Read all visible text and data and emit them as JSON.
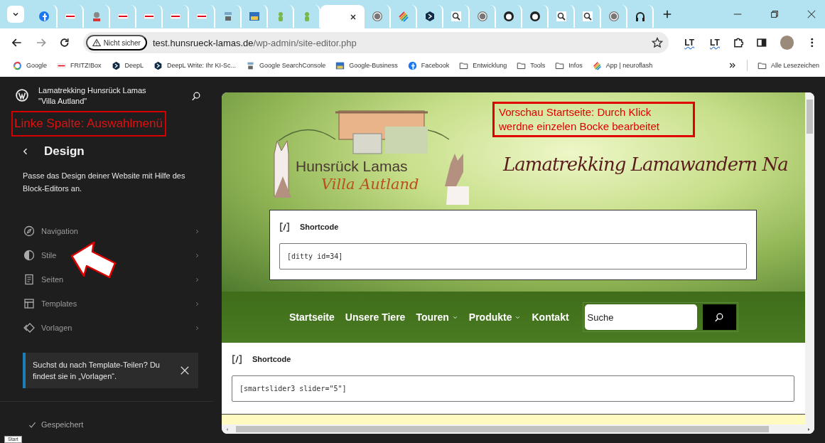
{
  "browser": {
    "tabs": [
      {
        "kind": "round",
        "selected": false
      },
      {
        "kind": "flag",
        "selected": false
      },
      {
        "kind": "person",
        "selected": false
      },
      {
        "kind": "flag",
        "selected": false
      },
      {
        "kind": "flag",
        "selected": false
      },
      {
        "kind": "flag",
        "selected": false
      },
      {
        "kind": "flag",
        "selected": false
      },
      {
        "kind": "server",
        "selected": false
      },
      {
        "kind": "grid",
        "selected": false
      },
      {
        "kind": "figure",
        "selected": false
      },
      {
        "kind": "figure",
        "selected": false
      },
      {
        "kind": "blank",
        "selected": true
      },
      {
        "kind": "wp",
        "selected": false
      },
      {
        "kind": "stripes",
        "selected": false
      },
      {
        "kind": "hex",
        "selected": false
      },
      {
        "kind": "magnifier",
        "selected": false
      },
      {
        "kind": "wp",
        "selected": false
      },
      {
        "kind": "github",
        "selected": false
      },
      {
        "kind": "github",
        "selected": false
      },
      {
        "kind": "magnifier",
        "selected": false
      },
      {
        "kind": "magnifier",
        "selected": false
      },
      {
        "kind": "wp",
        "selected": false
      },
      {
        "kind": "headphones",
        "selected": false
      }
    ],
    "address": {
      "security": "Nicht sicher",
      "host": "test.hunsrueck-lamas.de",
      "path": "/wp-admin/site-editor.php"
    },
    "extensions": [
      {
        "label": "LT"
      },
      {
        "label": "LT"
      }
    ],
    "bookmarks": [
      {
        "label": "Google",
        "kind": "gring"
      },
      {
        "label": "FRITZ!Box",
        "kind": "flag"
      },
      {
        "label": "DeepL",
        "kind": "hex"
      },
      {
        "label": "DeepL Write: Ihr KI-Sc...",
        "kind": "hex"
      },
      {
        "label": "Google SearchConsole",
        "kind": "server"
      },
      {
        "label": "Google-Business",
        "kind": "grid"
      },
      {
        "label": "Facebook",
        "kind": "round"
      },
      {
        "label": "Entwicklung",
        "kind": "folder"
      },
      {
        "label": "Tools",
        "kind": "folder"
      },
      {
        "label": "Infos",
        "kind": "folder"
      },
      {
        "label": "App | neuroflash",
        "kind": "stripes"
      }
    ],
    "all_bookmarks": "Alle Lesezeichen"
  },
  "sidebar": {
    "site_title": "Lamatrekking Hunsrück Lamas \"Villa Autland\"",
    "annotation": "Linke Spalte: Auswahlmenü",
    "heading": "Design",
    "description": "Passe das Design deiner Website mit Hilfe des Block-Editors an.",
    "items": [
      {
        "label": "Navigation",
        "kind": "navigation"
      },
      {
        "label": "Stile",
        "kind": "styles"
      },
      {
        "label": "Seiten",
        "kind": "pages"
      },
      {
        "label": "Templates",
        "kind": "templates"
      },
      {
        "label": "Vorlagen",
        "kind": "patterns"
      }
    ],
    "notice": "Suchst du nach Template-Teilen? Du findest sie in „Vorlagen“.",
    "save_status": "Gespeichert"
  },
  "preview": {
    "logo_title": "Hunsrück Lamas",
    "logo_subtitle": "Villa Autland",
    "tagline": "Lamatrekking Lamawandern Na",
    "annotation": "Vorschau Startseite: Durch Klick werdne einzelen Bocke bearbeitet",
    "hero_block": {
      "label": "Shortcode",
      "code": "[ditty id=34]"
    },
    "nav": [
      {
        "label": "Startseite",
        "has_submenu": false
      },
      {
        "label": "Unsere Tiere",
        "has_submenu": false
      },
      {
        "label": "Touren",
        "has_submenu": true
      },
      {
        "label": "Produkte",
        "has_submenu": true
      },
      {
        "label": "Kontakt",
        "has_submenu": false
      }
    ],
    "search_placeholder": "Suche",
    "content_block": {
      "label": "Shortcode",
      "code": "[smartslider3 slider=\"5\"]"
    }
  },
  "tooltip": "Start"
}
